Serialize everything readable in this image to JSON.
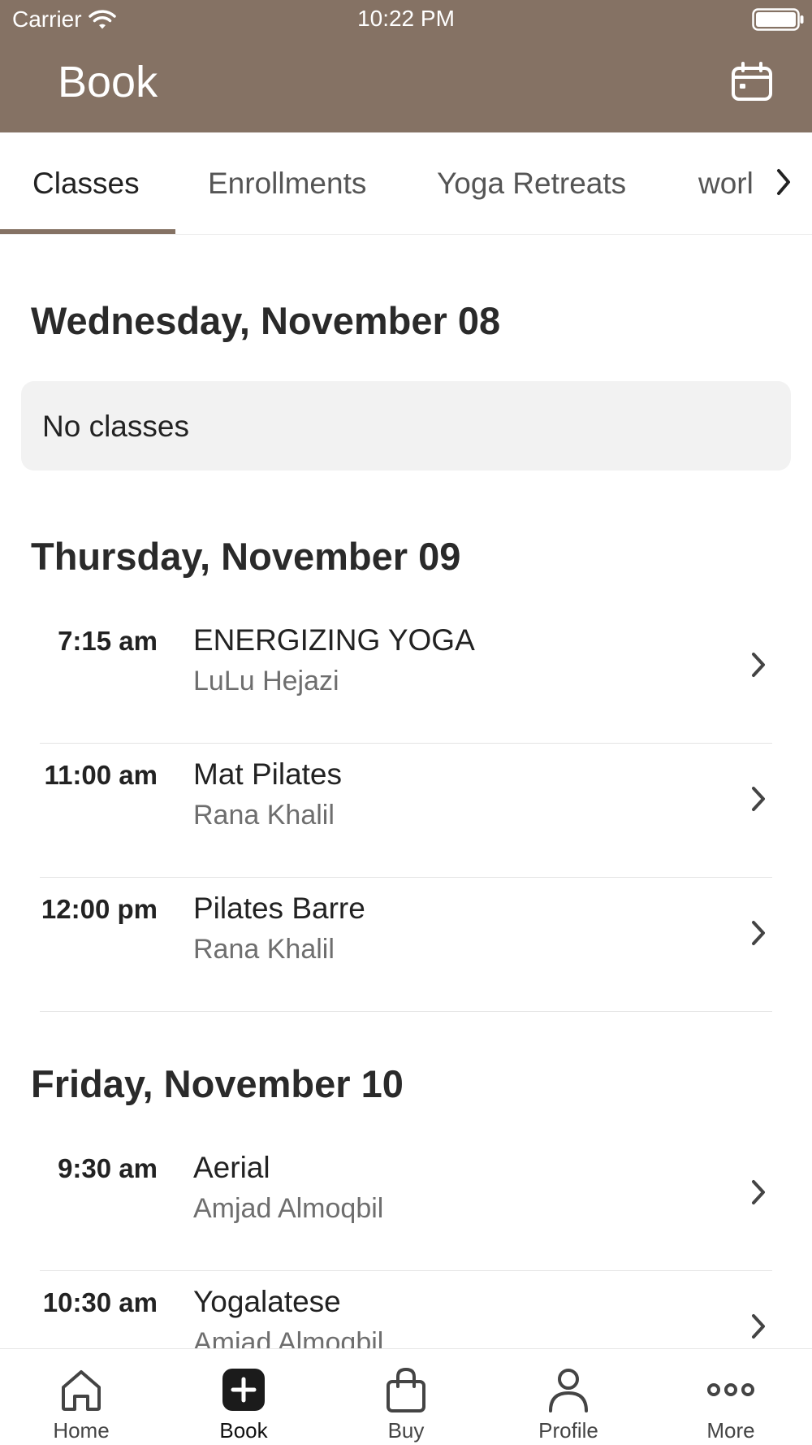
{
  "status_bar": {
    "carrier": "Carrier",
    "time": "10:22 PM"
  },
  "header": {
    "title": "Book",
    "calendar_icon": "calendar-icon",
    "bg_color": "#857264"
  },
  "tabs": {
    "items": [
      {
        "label": "Classes",
        "active": true
      },
      {
        "label": "Enrollments"
      },
      {
        "label": "Yoga Retreats"
      },
      {
        "label": "worl"
      }
    ]
  },
  "days": [
    {
      "heading": "Wednesday, November 08",
      "empty_text": "No classes"
    },
    {
      "heading": "Thursday, November 09",
      "classes": [
        {
          "time": "7:15 am",
          "name": "ENERGIZING YOGA",
          "instructor": "LuLu Hejazi"
        },
        {
          "time": "11:00 am",
          "name": "Mat Pilates",
          "instructor": "Rana Khalil"
        },
        {
          "time": "12:00 pm",
          "name": "Pilates Barre",
          "instructor": "Rana Khalil"
        }
      ]
    },
    {
      "heading": "Friday, November 10",
      "classes": [
        {
          "time": "9:30 am",
          "name": "Aerial",
          "instructor": "Amjad Almoqbil"
        },
        {
          "time": "10:30 am",
          "name": "Yogalatese",
          "instructor": "Amjad Almoqbil"
        }
      ]
    }
  ],
  "bottom_nav": {
    "items": [
      {
        "label": "Home",
        "icon": "home-icon"
      },
      {
        "label": "Book",
        "icon": "plus-square-icon",
        "active": true
      },
      {
        "label": "Buy",
        "icon": "shopping-bag-icon"
      },
      {
        "label": "Profile",
        "icon": "person-icon"
      },
      {
        "label": "More",
        "icon": "more-dots-icon"
      }
    ]
  }
}
